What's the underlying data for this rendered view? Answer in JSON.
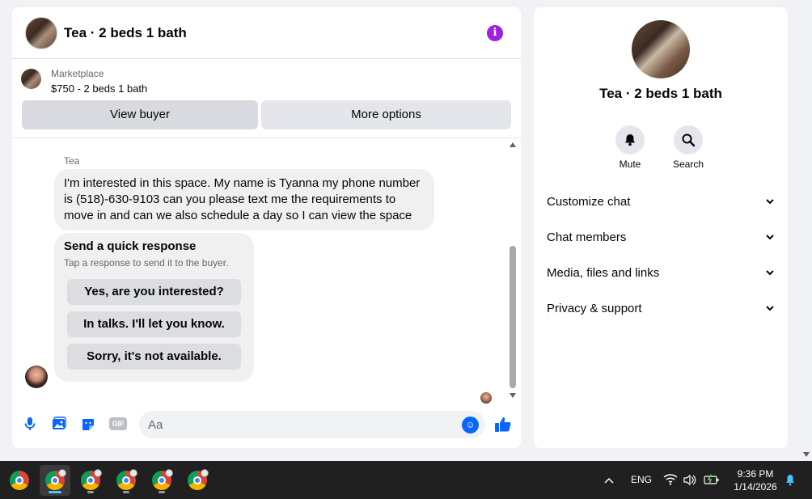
{
  "header": {
    "title": "Tea · 2 beds 1 bath"
  },
  "listing": {
    "source": "Marketplace",
    "price_line": "$750 - 2 beds 1 bath"
  },
  "buttons": {
    "view_buyer": "View buyer",
    "more_options": "More options"
  },
  "message": {
    "sender": "Tea",
    "text": "I'm interested in this space. My name is Tyanna my phone number is (518)-630-9103 can you please text me the requirements to move in and can we also schedule a day so I can view the space"
  },
  "quick_response": {
    "title": "Send a quick response",
    "subtitle": "Tap a response to send it to the buyer.",
    "options": [
      "Yes, are you interested?",
      "In talks. I'll let you know.",
      "Sorry, it's not available."
    ]
  },
  "composer": {
    "placeholder": "Aa",
    "gif_label": "GIF"
  },
  "info_panel": {
    "title": "Tea · 2 beds 1 bath",
    "actions": [
      {
        "label": "Mute",
        "icon": "bell-icon"
      },
      {
        "label": "Search",
        "icon": "search-icon"
      }
    ],
    "sections": [
      "Customize chat",
      "Chat members",
      "Media, files and links",
      "Privacy & support"
    ]
  },
  "taskbar": {
    "apps": [
      "chrome",
      "chrome",
      "chrome",
      "chrome",
      "chrome",
      "chrome"
    ],
    "language": "ENG",
    "time": "9:36 PM",
    "date": "1/14/2026"
  },
  "colors": {
    "accent": "#0866ff",
    "info": "#a020e0",
    "bubble": "#f0f0f0",
    "taskbar": "#202020"
  }
}
